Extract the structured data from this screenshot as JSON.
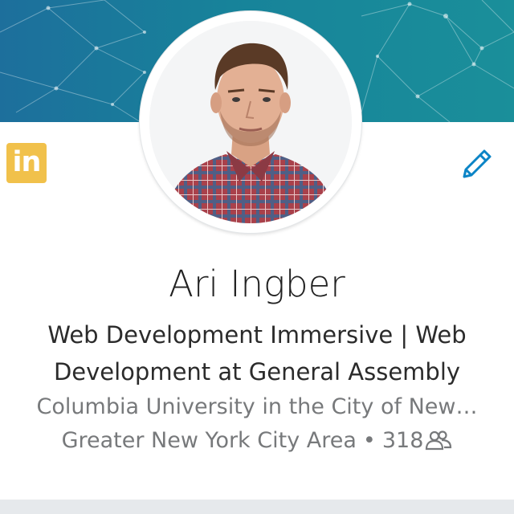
{
  "profile": {
    "name": "Ari Ingber",
    "headline": "Web Development Immersive | Web Development at General Assembly",
    "education": "Columbia University in the City of New…",
    "location": "Greater New York City Area",
    "separator": "•",
    "connections": "318"
  },
  "brand": {
    "logo_text": "in",
    "logo_color": "#f1c14b"
  },
  "icons": {
    "edit": "pencil-icon",
    "connections": "people-icon"
  },
  "colors": {
    "banner": "#1a7f9a",
    "accent": "#0b84c6",
    "text_primary": "#222222",
    "text_secondary": "#77797b"
  }
}
